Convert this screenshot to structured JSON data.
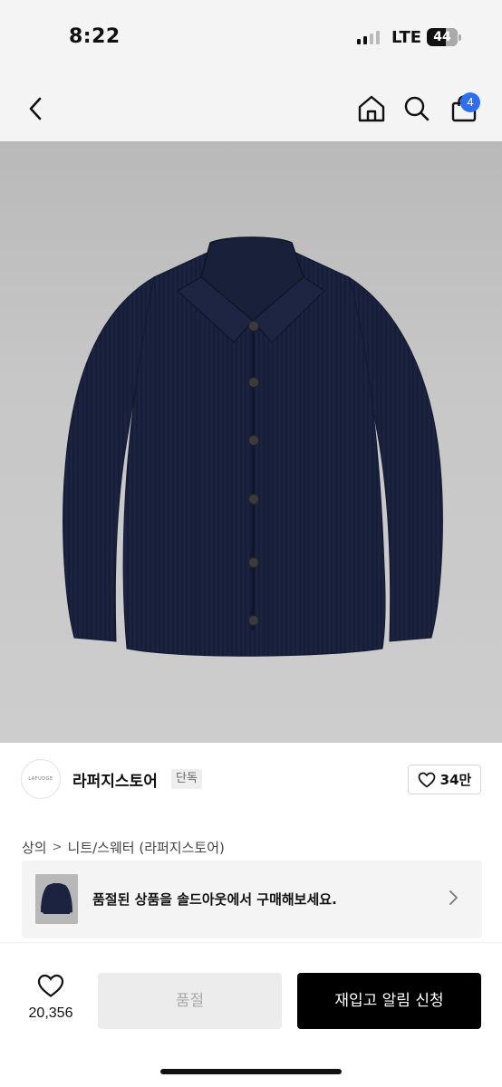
{
  "status_bar": {
    "time": "8:22",
    "network": "LTE",
    "battery": "44"
  },
  "nav": {
    "back_icon": "chevron-left-icon",
    "home_icon": "home-icon",
    "search_icon": "search-icon",
    "cart_icon": "shopping-bag-icon",
    "cart_count": "4"
  },
  "product": {
    "image_alt": "navy knit collar cardigan"
  },
  "store": {
    "logo_text": "LAFUDGE",
    "name": "라퍼지스토어",
    "tag": "단독",
    "likes": "34만"
  },
  "breadcrumb": {
    "level1": "상의",
    "separator": ">",
    "level2": "니트/스웨터 (라퍼지스토어)"
  },
  "soldout_banner": {
    "text": "품절된 상품을 솔드아웃에서 구매해보세요."
  },
  "bottom_bar": {
    "wish_count": "20,356",
    "soldout_label": "품절",
    "restock_label": "재입고 알림 신청"
  },
  "colors": {
    "accent_badge": "#2d6ff2",
    "primary_button": "#000000",
    "disabled_button": "#ececec",
    "garment": "#1b2340"
  }
}
